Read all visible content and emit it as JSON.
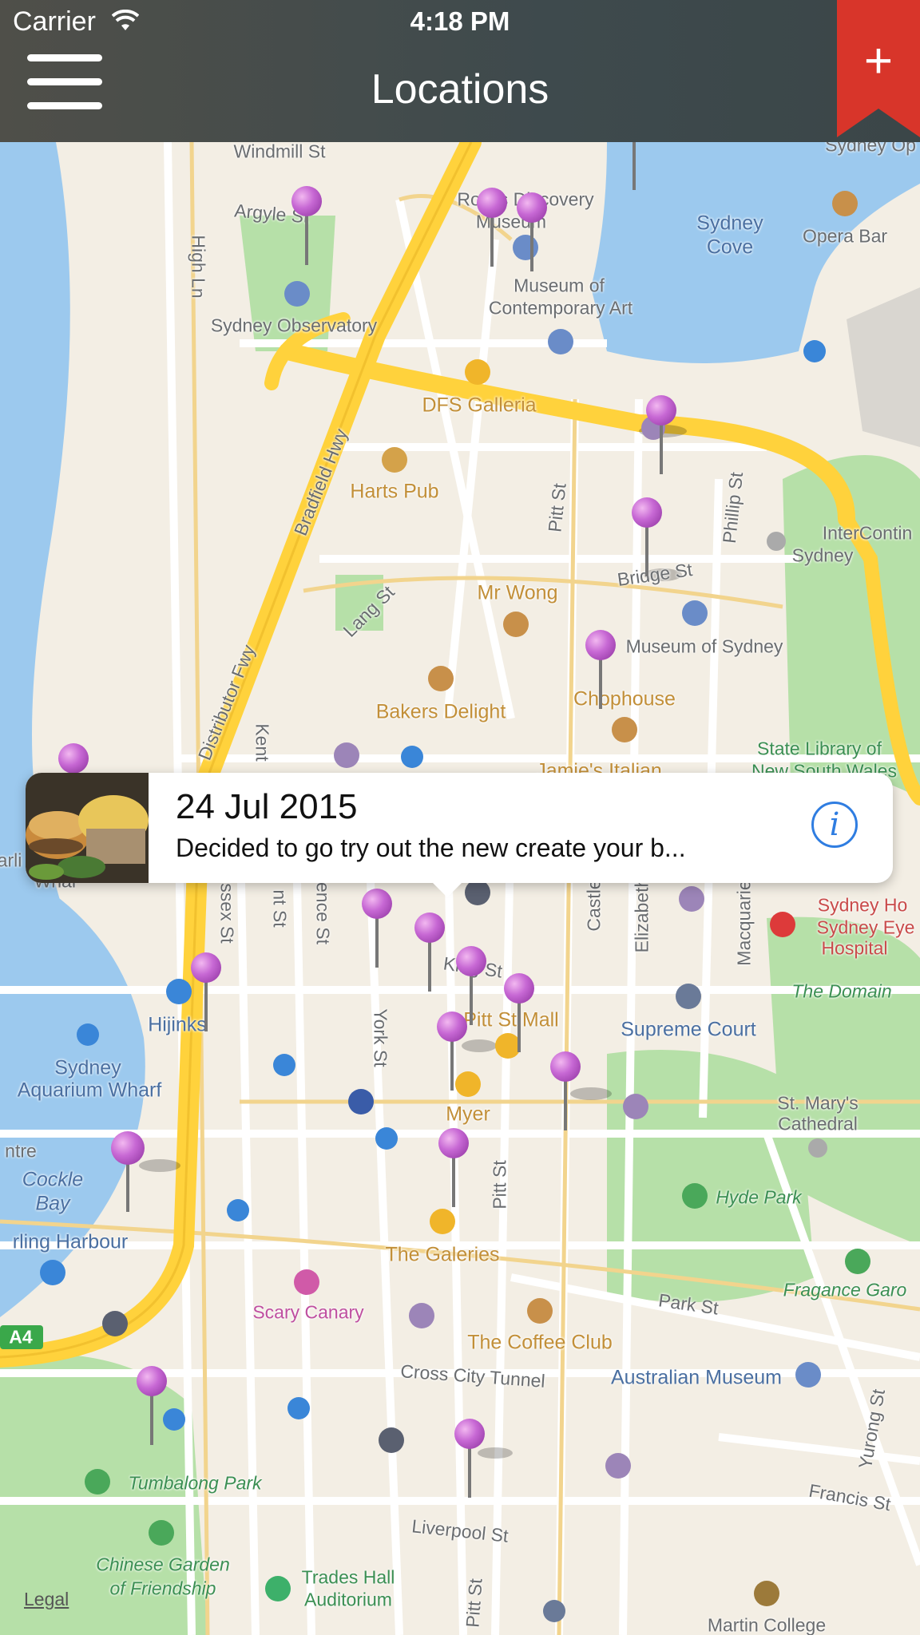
{
  "status_bar": {
    "carrier": "Carrier",
    "time": "4:18 PM"
  },
  "nav": {
    "title": "Locations",
    "menu_icon": "hamburger-menu-icon",
    "add_icon": "plus-bookmark-icon",
    "accent": "#d8352a"
  },
  "callout": {
    "date": "24 Jul 2015",
    "text": "Decided to go try out the new create your b...",
    "info_icon": "info-icon"
  },
  "map": {
    "legal": "Legal",
    "labels": {
      "windmill": "Windmill St",
      "argyle": "Argyle St",
      "rocks_discovery": "Rocks Discovery",
      "museum": "Museum",
      "sydney_op": "Sydney Op",
      "sydney_cove_1": "Sydney",
      "sydney_cove_2": "Cove",
      "opera_bar": "Opera Bar",
      "high": "High Ln",
      "observatory": "Sydney Observatory",
      "mca_1": "Museum of",
      "mca_2": "Contemporary Art",
      "dfs": "DFS Galleria",
      "bradfield": "Bradfield Hwy",
      "harts": "Harts Pub",
      "pitt1": "Pitt St",
      "phillip": "Phillip St",
      "intercont_1": "InterContin",
      "intercont_2": "Sydney",
      "mrwong": "Mr Wong",
      "bridge": "Bridge St",
      "lang": "Lang St",
      "museum_sydney": "Museum of Sydney",
      "chophouse": "Chophouse",
      "bakers": "Bakers Delight",
      "distributor": "Distributor Fwy",
      "kent": "Kent",
      "state_lib_1": "State Library of",
      "state_lib_2": "New South Wales",
      "jamies": "Jamie's Italian",
      "darling_1": "arli",
      "darling_2": "Whar",
      "sussex": "ssex St",
      "kent2": "nt St",
      "clarence": "ence St",
      "castle": "Castle",
      "elizabeth": "Elizabeth",
      "macquarie": "Macquarie",
      "hosp_1": "Sydney Ho",
      "hosp_2": "Sydney Eye",
      "hosp_3": "Hospital",
      "king": "King St",
      "domain": "The Domain",
      "hijinks": "Hijinks",
      "york": "York St",
      "pittmall": "Pitt St Mall",
      "supreme": "Supreme Court",
      "aquarium_1": "Sydney",
      "aquarium_2": "Aquarium Wharf",
      "myer": "Myer",
      "stmarys_1": "St. Mary's",
      "stmarys_2": "Cathedral",
      "centre": "ntre",
      "cockle_1": "Cockle",
      "cockle_2": "Bay",
      "pitt2": "Pitt St",
      "hydepark": "Hyde Park",
      "darlingharbour": "rling Harbour",
      "galeries": "The Galeries",
      "fragance": "Fragance Garo",
      "scary": "Scary Canary",
      "parkst": "Park St",
      "coffee": "The Coffee Club",
      "a4": "A4",
      "crosscity": "Cross City Tunnel",
      "australian": "Australian Museum",
      "tumbalong": "Tumbalong Park",
      "yurong": "Yurong St",
      "francis": "Francis St",
      "liverpool": "Liverpool St",
      "chinese_1": "Chinese Garden",
      "chinese_2": "of Friendship",
      "trades_1": "Trades Hall",
      "trades_2": "Auditorium",
      "pitt3": "Pitt St",
      "martin": "Martin College"
    }
  }
}
